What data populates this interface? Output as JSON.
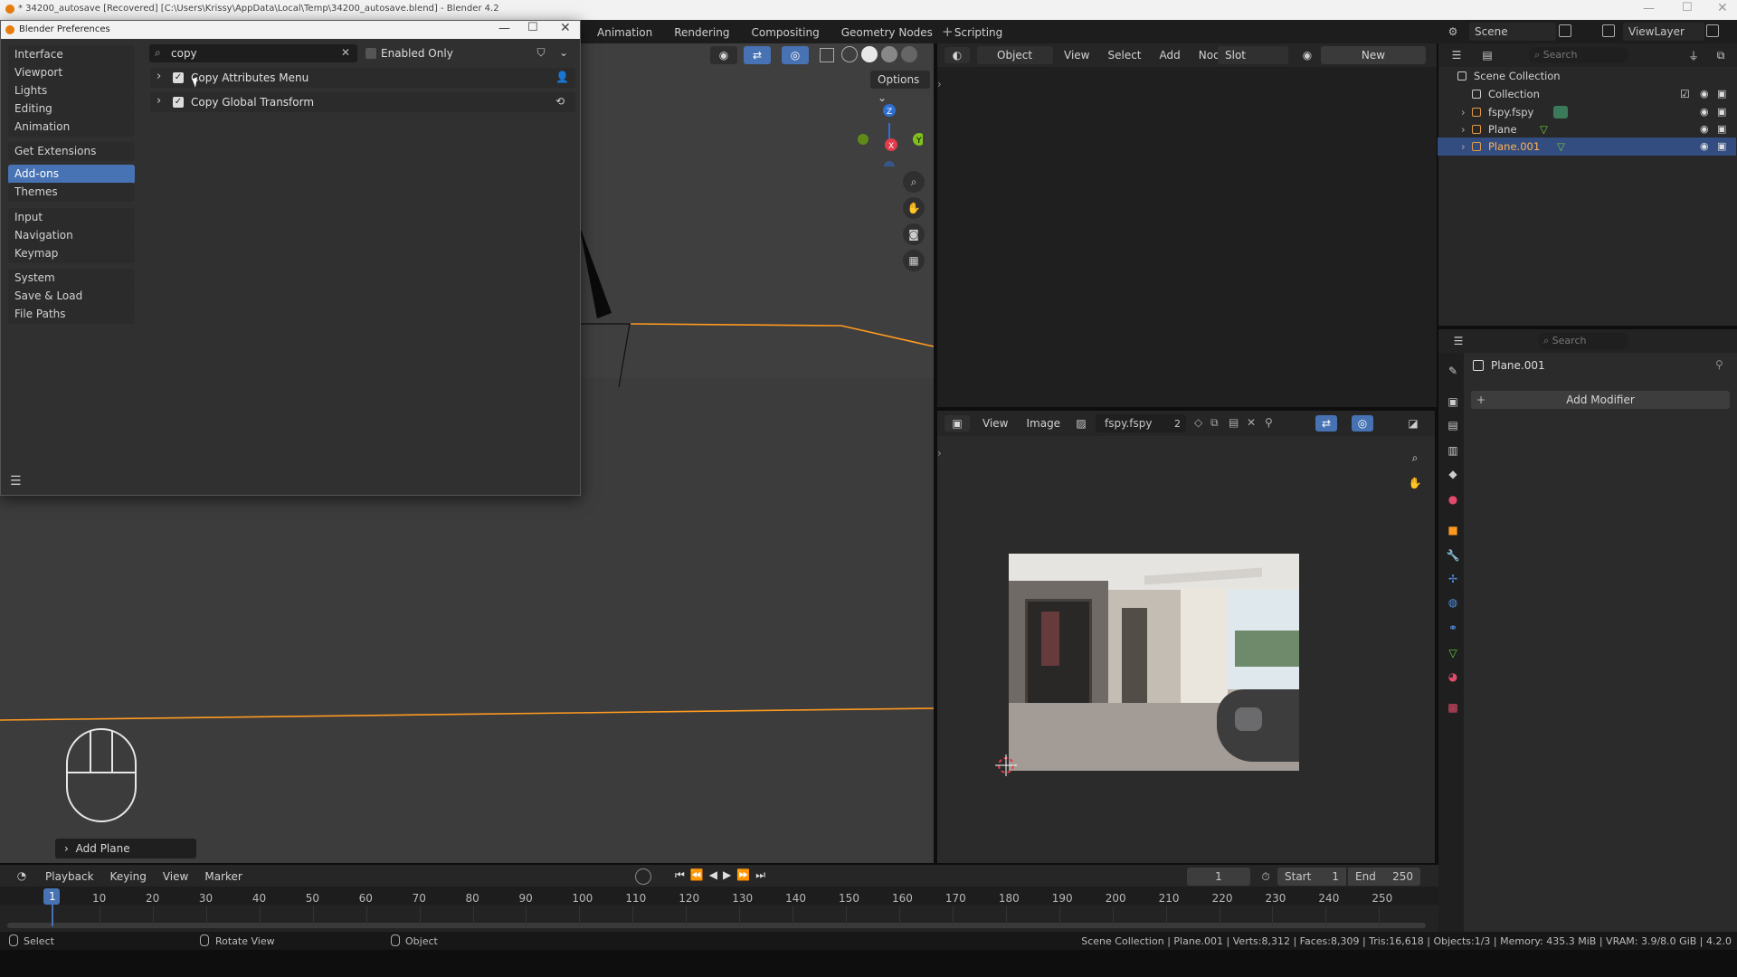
{
  "window": {
    "title": "* 34200_autosave [Recovered] [C:\\Users\\Krissy\\AppData\\Local\\Temp\\34200_autosave.blend] - Blender 4.2"
  },
  "topbar": {
    "tabs": [
      "Animation",
      "Rendering",
      "Compositing",
      "Geometry Nodes",
      "Scripting"
    ],
    "scene_label": "Scene",
    "viewlayer_label": "ViewLayer"
  },
  "prefs": {
    "title": "Blender Preferences",
    "search_value": "copy",
    "enabled_only_label": "Enabled Only",
    "sidebar": [
      {
        "label": "Interface",
        "active": false
      },
      {
        "label": "Viewport",
        "active": false
      },
      {
        "label": "Lights",
        "active": false
      },
      {
        "label": "Editing",
        "active": false
      },
      {
        "label": "Animation",
        "active": false
      },
      {
        "label": "Get Extensions",
        "active": false
      },
      {
        "label": "Add-ons",
        "active": true
      },
      {
        "label": "Themes",
        "active": false
      },
      {
        "label": "Input",
        "active": false
      },
      {
        "label": "Navigation",
        "active": false
      },
      {
        "label": "Keymap",
        "active": false
      },
      {
        "label": "System",
        "active": false
      },
      {
        "label": "Save & Load",
        "active": false
      },
      {
        "label": "File Paths",
        "active": false
      }
    ],
    "addons": [
      {
        "label": "Copy Attributes Menu",
        "enabled": true
      },
      {
        "label": "Copy Global Transform",
        "enabled": true
      }
    ]
  },
  "viewport": {
    "options_label": "Options",
    "operator_panel": "Add Plane"
  },
  "node_editor": {
    "mode": "Object",
    "menus": [
      "View",
      "Select",
      "Add",
      "Node"
    ],
    "slot": "Slot",
    "new_label": "New"
  },
  "image_editor": {
    "menus": [
      "View",
      "Image"
    ],
    "image_name": "fspy.fspy",
    "users": "2"
  },
  "outliner": {
    "search_placeholder": "Search",
    "items": [
      {
        "label": "Scene Collection",
        "selected": false
      },
      {
        "label": "Collection",
        "selected": false
      },
      {
        "label": "fspy.fspy",
        "selected": false
      },
      {
        "label": "Plane",
        "selected": false
      },
      {
        "label": "Plane.001",
        "selected": true
      }
    ]
  },
  "properties": {
    "search_placeholder": "Search",
    "object_name": "Plane.001",
    "add_modifier": "Add Modifier"
  },
  "timeline": {
    "menus": [
      "Playback",
      "Keying",
      "View",
      "Marker"
    ],
    "current_frame": "1",
    "start_label": "Start",
    "start": "1",
    "end_label": "End",
    "end": "250",
    "ticks": [
      "1",
      "10",
      "20",
      "30",
      "40",
      "50",
      "60",
      "70",
      "80",
      "90",
      "100",
      "110",
      "120",
      "130",
      "140",
      "150",
      "160",
      "170",
      "180",
      "190",
      "200",
      "210",
      "220",
      "230",
      "240",
      "250"
    ]
  },
  "statusbar": {
    "select": "Select",
    "rotate": "Rotate View",
    "object": "Object",
    "stats": "Scene Collection | Plane.001 | Verts:8,312 | Faces:8,309 | Tris:16,618 | Objects:1/3 | Memory: 435.3 MiB | VRAM: 3.9/8.0 GiB | 4.2.0"
  },
  "colors": {
    "accent": "#4772b3",
    "selection": "#ff9a1f",
    "bg": "#303030"
  }
}
